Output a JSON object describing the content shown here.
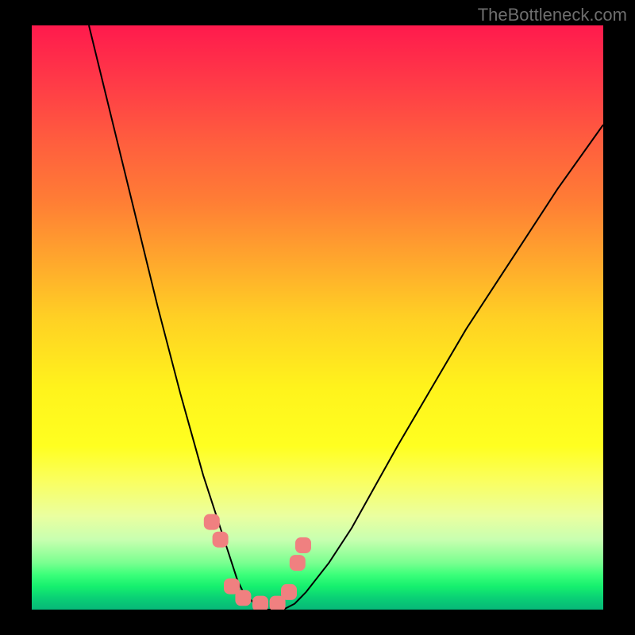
{
  "watermark": "TheBottleneck.com",
  "chart_data": {
    "type": "line",
    "title": "",
    "xlabel": "",
    "ylabel": "",
    "xlim": [
      0,
      100
    ],
    "ylim": [
      0,
      100
    ],
    "grid": false,
    "legend": false,
    "series": [
      {
        "name": "curve",
        "x": [
          10,
          14,
          18,
          22,
          26,
          28,
          30,
          32,
          33,
          34,
          35,
          36,
          37,
          38,
          40,
          42,
          44,
          46,
          48,
          52,
          56,
          60,
          64,
          70,
          76,
          84,
          92,
          100
        ],
        "y": [
          100,
          84,
          68,
          52,
          37,
          30,
          23,
          17,
          14,
          11,
          8,
          5,
          3,
          2,
          0,
          0,
          0,
          1,
          3,
          8,
          14,
          21,
          28,
          38,
          48,
          60,
          72,
          83
        ]
      },
      {
        "name": "markers",
        "x": [
          31.5,
          33,
          35,
          37,
          40,
          43,
          45,
          46.5,
          47.5
        ],
        "y": [
          15,
          12,
          4,
          2,
          1,
          1,
          3,
          8,
          11
        ]
      }
    ],
    "annotations": []
  },
  "colors": {
    "curve": "#000000",
    "marker": "#F08080",
    "background_top": "#ff1a4d",
    "background_bottom": "#07b878"
  }
}
